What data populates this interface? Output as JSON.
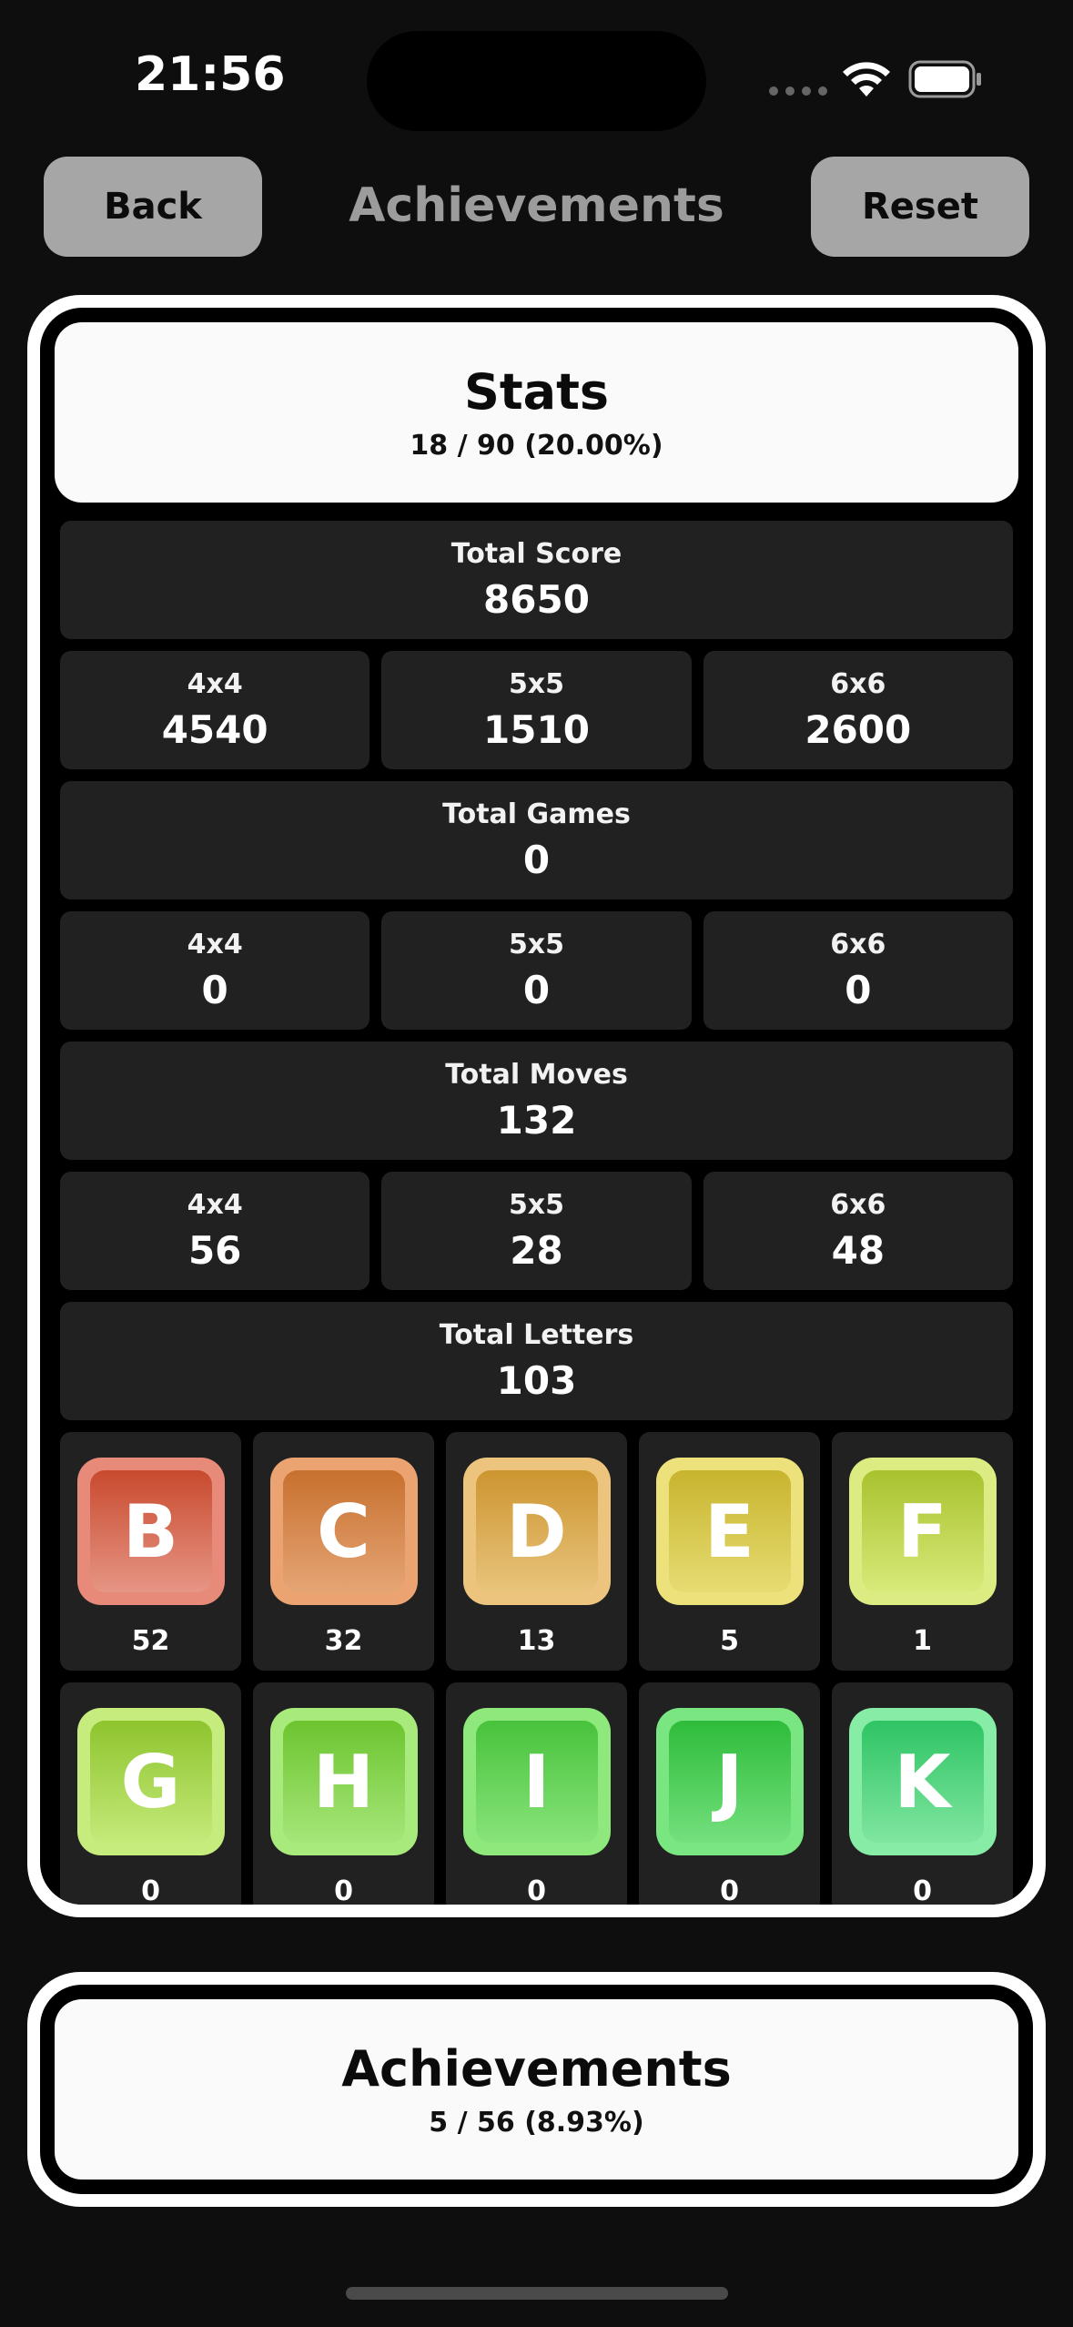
{
  "status_bar": {
    "time": "21:56"
  },
  "header": {
    "back_label": "Back",
    "title": "Achievements",
    "reset_label": "Reset"
  },
  "stats": {
    "title": "Stats",
    "progress": "18 / 90 (20.00%)",
    "total_score": {
      "label": "Total Score",
      "value": "8650"
    },
    "score_by_size": [
      {
        "label": "4x4",
        "value": "4540"
      },
      {
        "label": "5x5",
        "value": "1510"
      },
      {
        "label": "6x6",
        "value": "2600"
      }
    ],
    "total_games": {
      "label": "Total Games",
      "value": "0"
    },
    "games_by_size": [
      {
        "label": "4x4",
        "value": "0"
      },
      {
        "label": "5x5",
        "value": "0"
      },
      {
        "label": "6x6",
        "value": "0"
      }
    ],
    "total_moves": {
      "label": "Total Moves",
      "value": "132"
    },
    "moves_by_size": [
      {
        "label": "4x4",
        "value": "56"
      },
      {
        "label": "5x5",
        "value": "28"
      },
      {
        "label": "6x6",
        "value": "48"
      }
    ],
    "total_letters": {
      "label": "Total Letters",
      "value": "103"
    },
    "letters": [
      {
        "letter": "B",
        "count": "52",
        "outer": "#e88a7a",
        "face_top": "#c84a2e",
        "face_bottom": "#e69585"
      },
      {
        "letter": "C",
        "count": "32",
        "outer": "#eba371",
        "face_top": "#c8702e",
        "face_bottom": "#e5a575"
      },
      {
        "letter": "D",
        "count": "13",
        "outer": "#edc47d",
        "face_top": "#cc9530",
        "face_bottom": "#e9c47c"
      },
      {
        "letter": "E",
        "count": "5",
        "outer": "#ece17a",
        "face_top": "#c8b42e",
        "face_bottom": "#e6dc72"
      },
      {
        "letter": "F",
        "count": "1",
        "outer": "#dcec82",
        "face_top": "#a8c22e",
        "face_bottom": "#d8ea7a"
      },
      {
        "letter": "G",
        "count": "0",
        "outer": "#c6ec7e",
        "face_top": "#8ec42e",
        "face_bottom": "#c4ea7a"
      },
      {
        "letter": "H",
        "count": "0",
        "outer": "#a9ea7c",
        "face_top": "#6cc42e",
        "face_bottom": "#a6e67a"
      },
      {
        "letter": "I",
        "count": "0",
        "outer": "#8ee87c",
        "face_top": "#48c23c",
        "face_bottom": "#88e47a"
      },
      {
        "letter": "J",
        "count": "0",
        "outer": "#7ae682",
        "face_top": "#2ebc3a",
        "face_bottom": "#74e07e"
      },
      {
        "letter": "K",
        "count": "0",
        "outer": "#86eca6",
        "face_top": "#2ec464",
        "face_bottom": "#80e6a0"
      }
    ]
  },
  "achievements": {
    "title": "Achievements",
    "progress": "5 / 56 (8.93%)"
  }
}
